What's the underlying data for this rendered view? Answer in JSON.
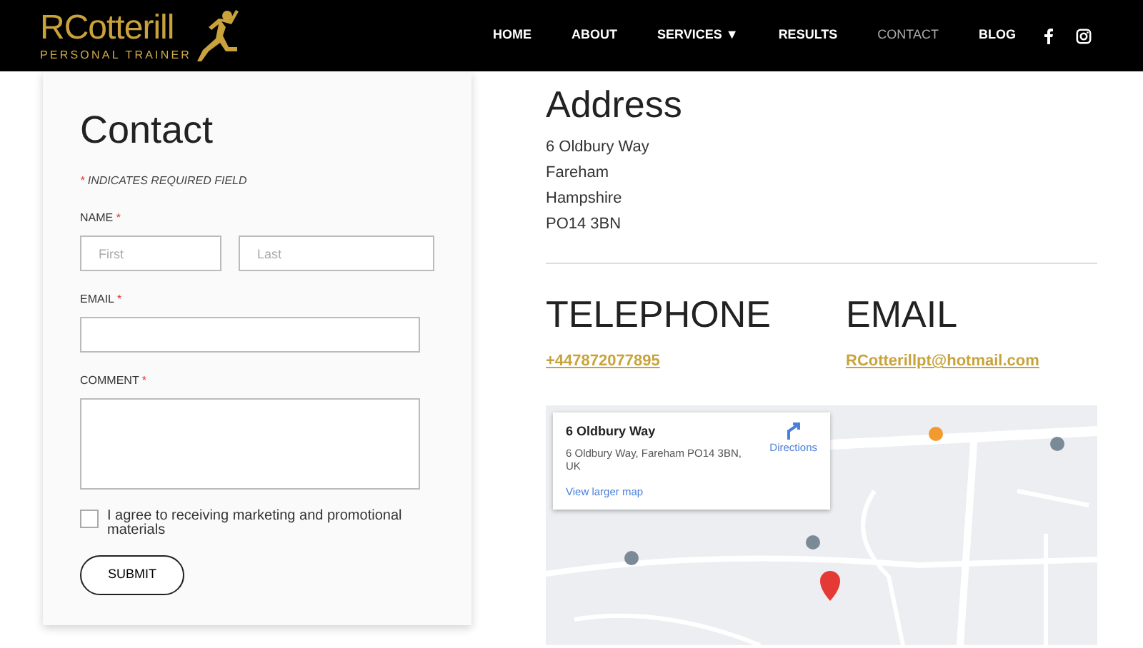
{
  "navbar": {
    "logo": {
      "name": "RCotterill",
      "tagline": "PERSONAL TRAINER"
    },
    "items": [
      {
        "label": "HOME",
        "selected": false
      },
      {
        "label": "ABOUT",
        "selected": false
      },
      {
        "label": "SERVICES ▼",
        "selected": false
      },
      {
        "label": "RESULTS",
        "selected": false
      },
      {
        "label": "CONTACT",
        "selected": true
      },
      {
        "label": "BLOG",
        "selected": false
      }
    ],
    "social": [
      {
        "kind": "facebook"
      },
      {
        "kind": "instagram"
      }
    ]
  },
  "form": {
    "title": "Contact",
    "required_note": {
      "mark": "*",
      "text": "INDICATES REQUIRED FIELD"
    },
    "fields": [
      {
        "kind": "pair",
        "label": "NAME",
        "required_mark": "*",
        "inputs": [
          {
            "placeholder": "First"
          },
          {
            "placeholder": "Last"
          }
        ]
      },
      {
        "kind": "text",
        "label": "EMAIL",
        "required_mark": "*"
      },
      {
        "kind": "textarea",
        "label": "COMMENT",
        "required_mark": "*"
      }
    ],
    "consent": {
      "label": "I agree to receiving marketing and promotional materials",
      "checked": false
    },
    "submit": "SUBMIT"
  },
  "address": {
    "heading": "Address",
    "lines": [
      "6 Oldbury Way",
      "Fareham",
      "Hampshire",
      "PO14 3BN"
    ]
  },
  "telephone": {
    "heading": "TELEPHONE",
    "link": "+447872077895"
  },
  "email": {
    "heading": "EMAIL",
    "link": "RCotterillpt@hotmail.com"
  },
  "map": {
    "kind": "picture",
    "info_card": {
      "title": "6 Oldbury Way",
      "address": "6 Oldbury Way, Fareham PO14 3BN, UK",
      "directions": "Directions",
      "larger_map": "View larger map"
    }
  }
}
